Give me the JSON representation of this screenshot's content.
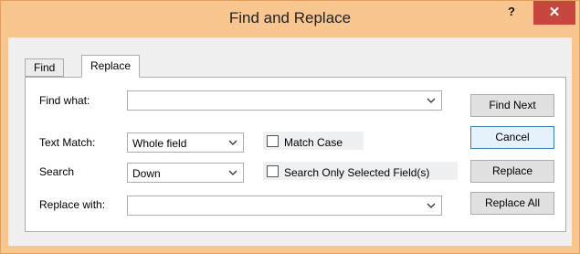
{
  "window": {
    "title": "Find and Replace",
    "help_label": "?",
    "close_label": "✕"
  },
  "tabs": [
    {
      "label": "Find"
    },
    {
      "label": "Replace"
    }
  ],
  "form": {
    "find_what": {
      "label": "Find what:",
      "value": ""
    },
    "text_match": {
      "label": "Text Match:",
      "value": "Whole field"
    },
    "search": {
      "label": "Search",
      "value": "Down"
    },
    "replace_with": {
      "label": "Replace with:",
      "value": ""
    },
    "match_case": {
      "label": "Match Case",
      "checked": false
    },
    "selected_fields": {
      "label": "Search Only Selected Field(s)",
      "checked": false
    }
  },
  "buttons": {
    "find_next": "Find Next",
    "cancel": "Cancel",
    "replace": "Replace",
    "replace_all": "Replace All"
  },
  "colors": {
    "title_bar": "#f9c690",
    "close": "#c7463d",
    "accent": "#3c7fb1"
  },
  "icons": {
    "dropdown": "chevron-down-icon"
  }
}
